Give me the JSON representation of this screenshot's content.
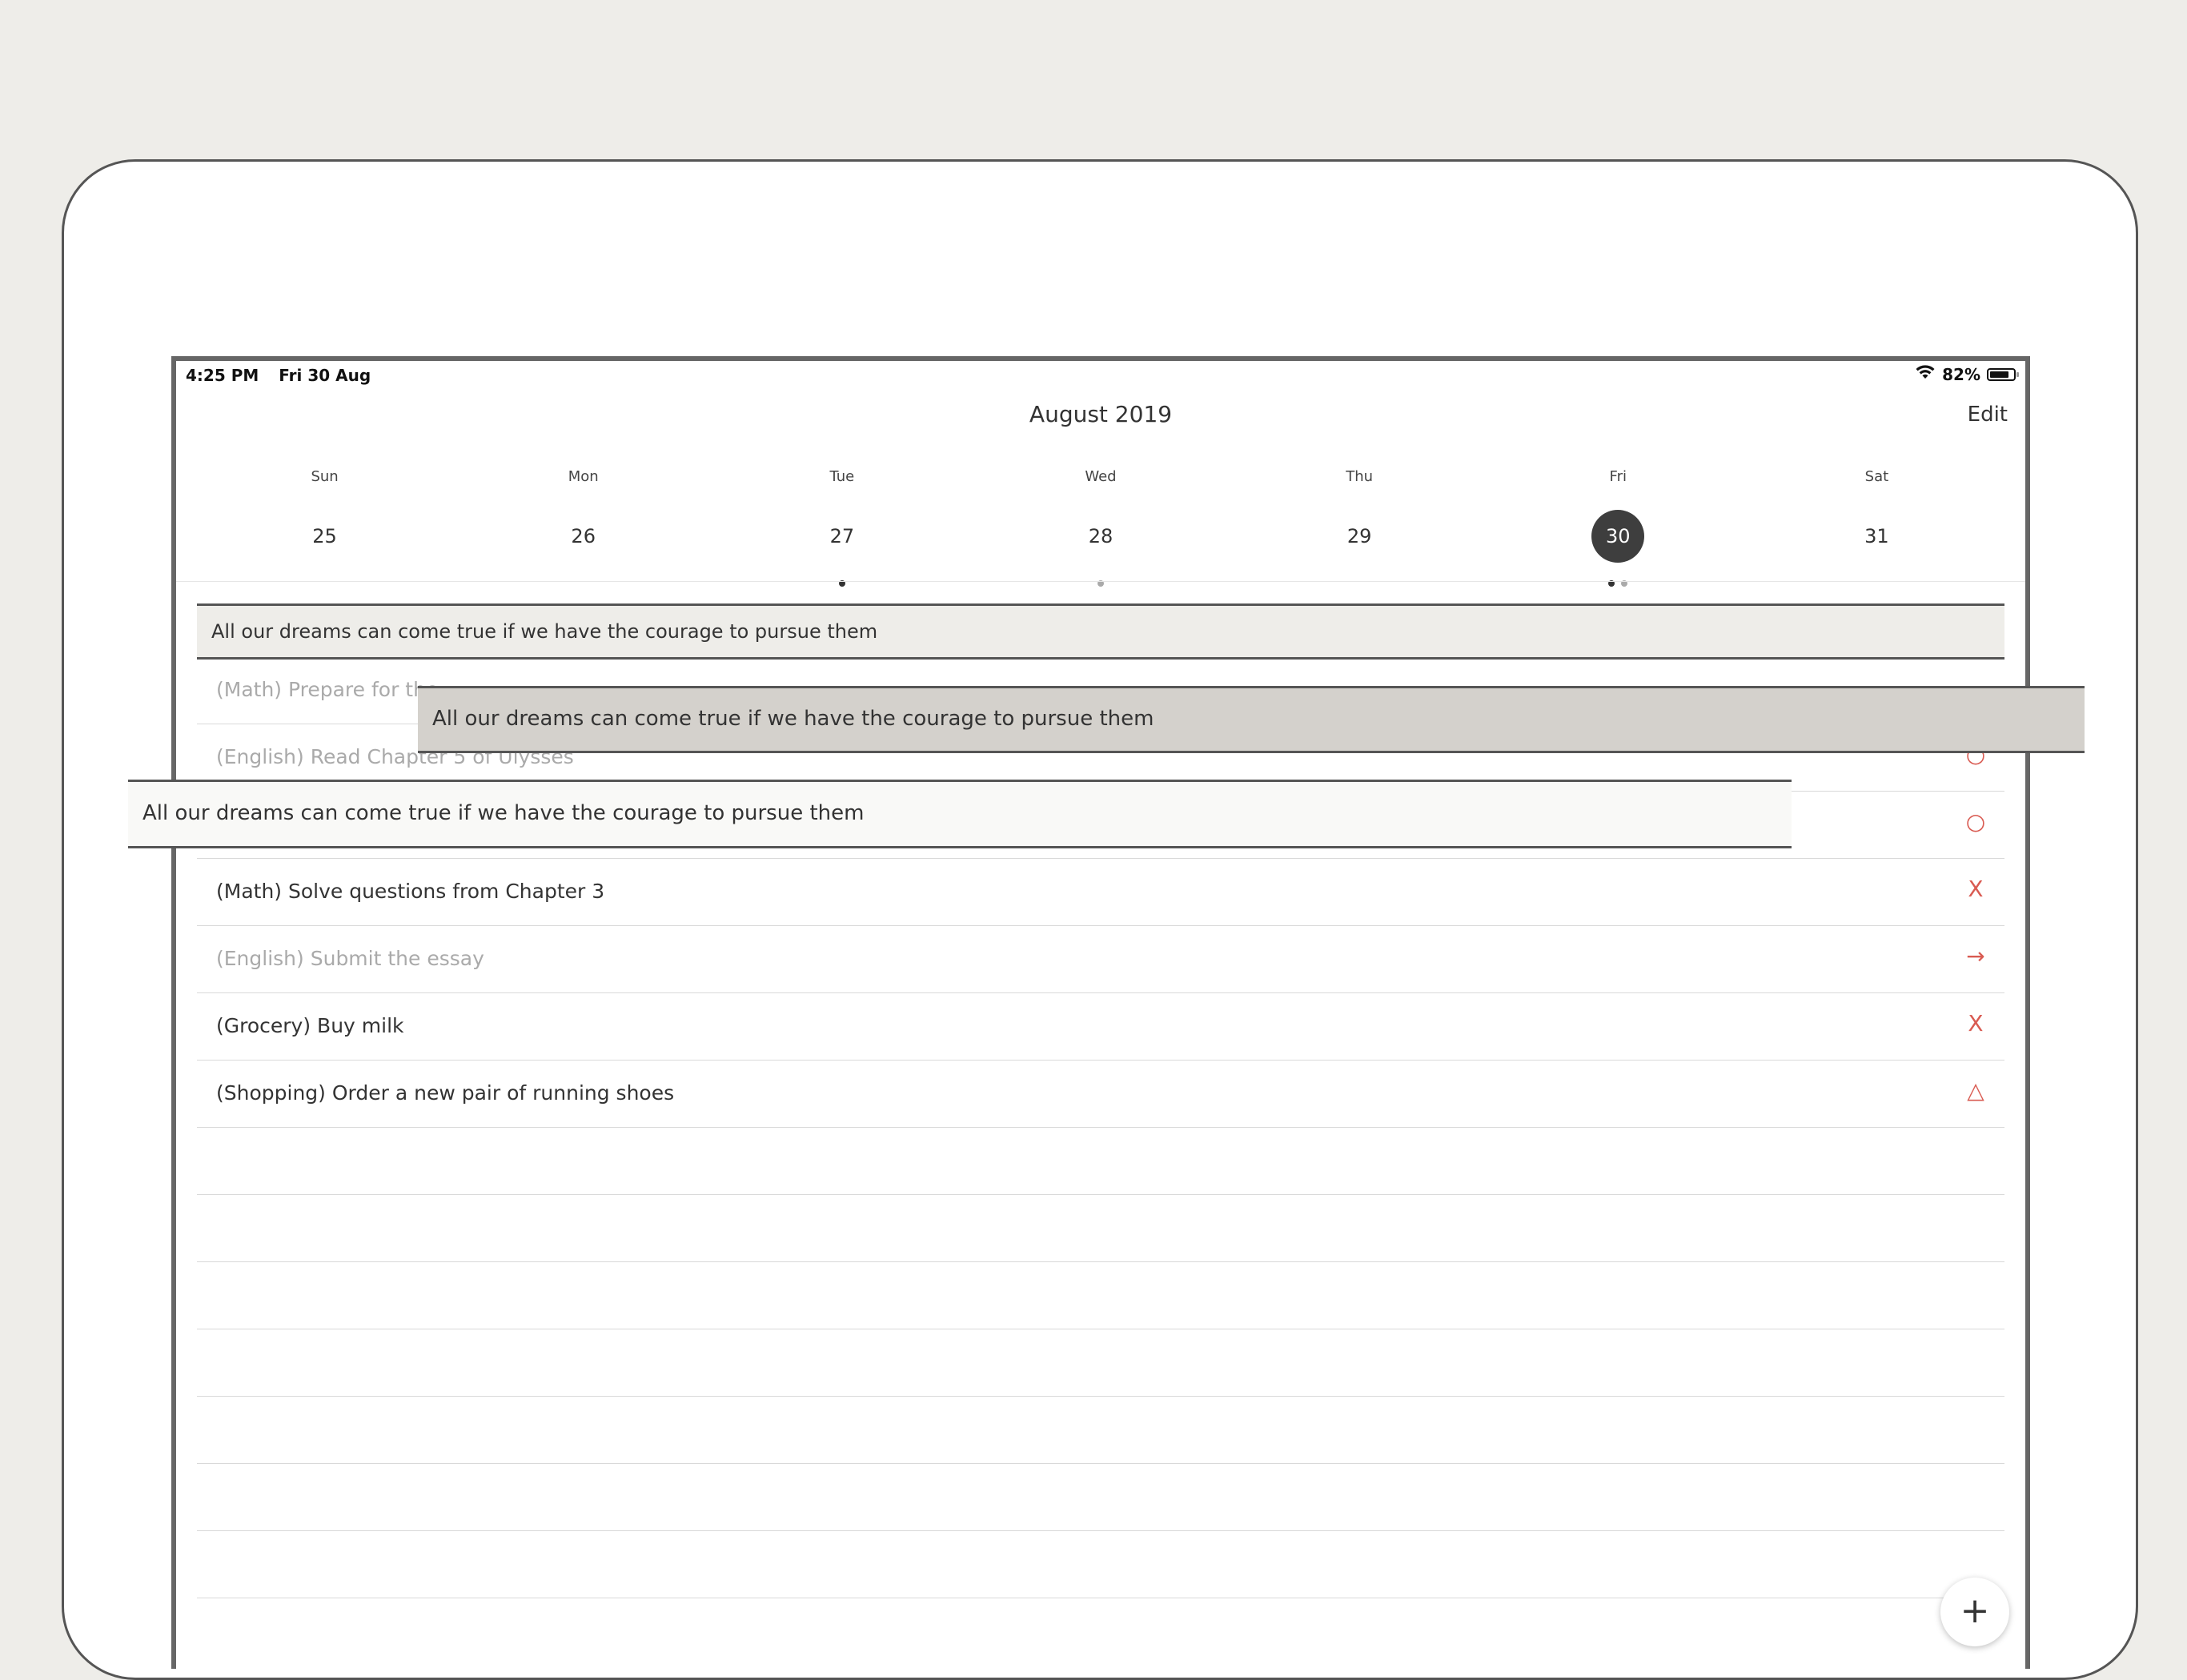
{
  "status": {
    "time": "4:25 PM",
    "date": "Fri 30 Aug",
    "battery": "82%",
    "battery_level": 0.82
  },
  "header": {
    "title": "August 2019",
    "edit_label": "Edit"
  },
  "week": {
    "days": [
      {
        "dow": "Sun",
        "num": "25",
        "selected": false,
        "dots": []
      },
      {
        "dow": "Mon",
        "num": "26",
        "selected": false,
        "dots": []
      },
      {
        "dow": "Tue",
        "num": "27",
        "selected": false,
        "dots": [
          "#333333"
        ]
      },
      {
        "dow": "Wed",
        "num": "28",
        "selected": false,
        "dots": [
          "#aaaaaa"
        ]
      },
      {
        "dow": "Thu",
        "num": "29",
        "selected": false,
        "dots": []
      },
      {
        "dow": "Fri",
        "num": "30",
        "selected": true,
        "dots": [
          "#333333",
          "#aaaaaa"
        ]
      },
      {
        "dow": "Sat",
        "num": "31",
        "selected": false,
        "dots": []
      }
    ]
  },
  "quote": "All our dreams can come true if we have the courage to pursue them",
  "overlays": {
    "banner_a": "All our dreams can come true if we have the courage to pursue them",
    "banner_b": "All our dreams can come true if we have the courage to pursue them"
  },
  "tasks": [
    {
      "text": "(Math) Prepare for the",
      "muted": true,
      "mark": ""
    },
    {
      "text": "(English) Read Chapter 5 of Ulysses",
      "muted": true,
      "mark": "○"
    },
    {
      "text": "",
      "muted": false,
      "mark": "○"
    },
    {
      "text": "(Math) Solve questions from Chapter 3",
      "muted": false,
      "mark": "X"
    },
    {
      "text": "(English) Submit the essay",
      "muted": true,
      "mark": "→"
    },
    {
      "text": "(Grocery) Buy milk",
      "muted": false,
      "mark": "X"
    },
    {
      "text": "(Shopping) Order a new pair of running shoes",
      "muted": false,
      "mark": "△"
    },
    {
      "text": "",
      "muted": false,
      "mark": ""
    },
    {
      "text": "",
      "muted": false,
      "mark": ""
    },
    {
      "text": "",
      "muted": false,
      "mark": ""
    },
    {
      "text": "",
      "muted": false,
      "mark": ""
    },
    {
      "text": "",
      "muted": false,
      "mark": ""
    },
    {
      "text": "",
      "muted": false,
      "mark": ""
    },
    {
      "text": "",
      "muted": false,
      "mark": ""
    }
  ],
  "add_button": "+",
  "colors": {
    "accent": "#d95b52",
    "selected_day": "#3e3e3e",
    "banner_bg": "#eeede9"
  }
}
